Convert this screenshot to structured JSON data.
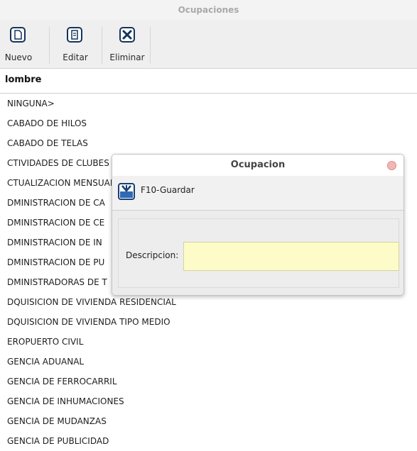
{
  "window": {
    "title": "Ocupaciones"
  },
  "toolbar": {
    "nuevo": {
      "label": "Nuevo",
      "icon": "new-document-icon"
    },
    "editar": {
      "label": "Editar",
      "icon": "edit-document-icon"
    },
    "eliminar": {
      "label": "Eliminar",
      "icon": "delete-x-icon"
    }
  },
  "table": {
    "header": "lombre",
    "rows": [
      "NINGUNA>",
      "CABADO DE HILOS",
      "CABADO DE TELAS",
      "CTIVIDADES DE CLUBES DEPORTIVOS PROFESIONALES",
      "CTUALIZACION MENSUAL",
      "DMINISTRACION DE CA",
      "DMINISTRACION DE CE",
      "DMINISTRACION DE IN",
      "DMINISTRACION DE PU",
      "DMINISTRADORAS DE T",
      "DQUISICION DE VIVIENDA RESIDENCIAL",
      "DQUISICION DE VIVIENDA TIPO MEDIO",
      "EROPUERTO CIVIL",
      "GENCIA ADUANAL",
      "GENCIA DE FERROCARRIL",
      "GENCIA DE INHUMACIONES",
      "GENCIA DE MUDANZAS",
      "GENCIA DE PUBLICIDAD"
    ]
  },
  "dialog": {
    "title": "Ocupacion",
    "save_label": "F10-Guardar",
    "save_icon": "save-disk-icon",
    "description_label": "Descripcion:",
    "description_value": ""
  },
  "colors": {
    "input_bg": "#fdfbc8",
    "close_button": "#f3b6b6",
    "icon_blue": "#1a3f73"
  }
}
